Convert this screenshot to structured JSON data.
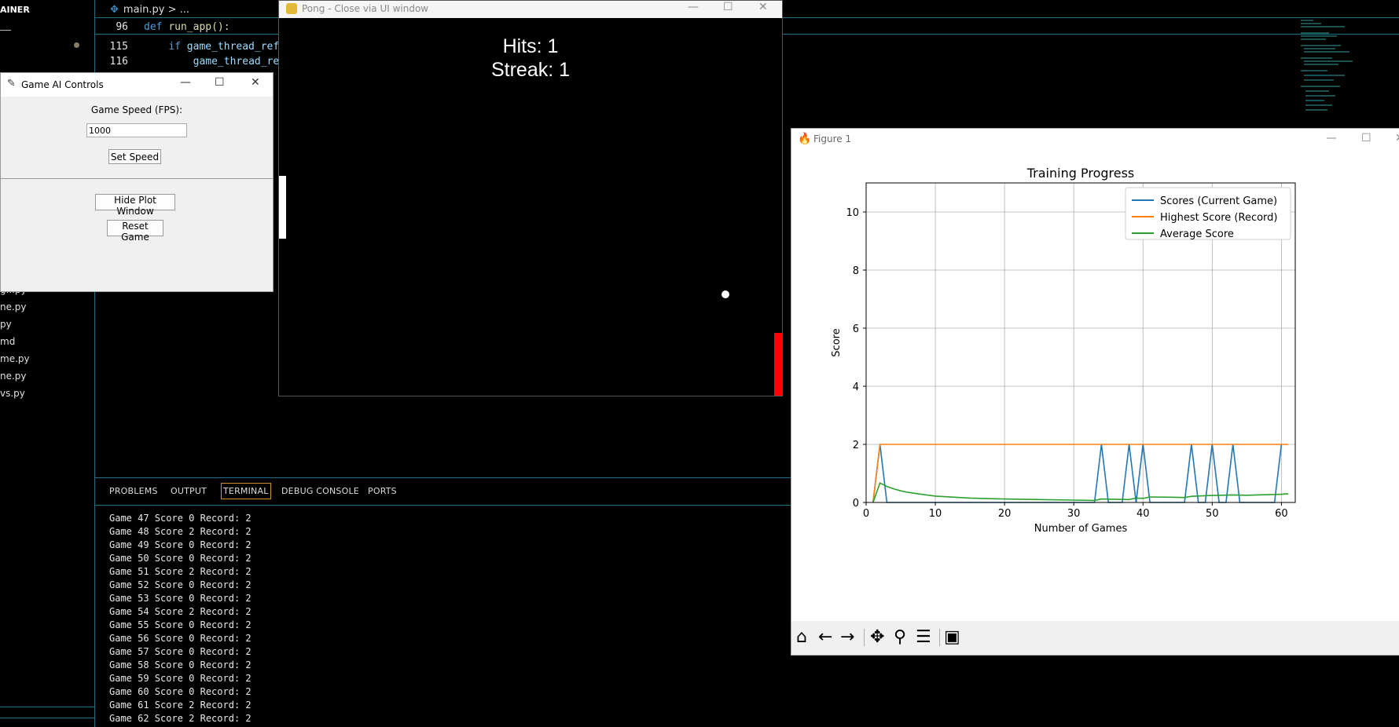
{
  "explorer": {
    "title": "AINER",
    "files": [
      "g...py",
      "ne.py",
      "py",
      "md",
      "me.py",
      "ne.py",
      "vs.py"
    ]
  },
  "editor": {
    "breadcrumb_file": "main.py",
    "breadcrumb_rest": "> ...",
    "lines": [
      {
        "num": "96",
        "kw": "def",
        "name": "run_app",
        "rest": "():"
      },
      {
        "num": "115",
        "indent": "    ",
        "kw": "if",
        "rest": " game_thread_ref"
      },
      {
        "num": "116",
        "indent": "        ",
        "kw": "",
        "rest": "game_thread_re"
      }
    ]
  },
  "panel": {
    "tabs": [
      "PROBLEMS",
      "OUTPUT",
      "TERMINAL",
      "DEBUG CONSOLE",
      "PORTS"
    ],
    "active_tab": "TERMINAL",
    "terminal_lines": [
      "Game 47 Score 0 Record: 2",
      "Game 48 Score 2 Record: 2",
      "Game 49 Score 0 Record: 2",
      "Game 50 Score 0 Record: 2",
      "Game 51 Score 2 Record: 2",
      "Game 52 Score 0 Record: 2",
      "Game 53 Score 0 Record: 2",
      "Game 54 Score 2 Record: 2",
      "Game 55 Score 0 Record: 2",
      "Game 56 Score 0 Record: 2",
      "Game 57 Score 0 Record: 2",
      "Game 58 Score 0 Record: 2",
      "Game 59 Score 0 Record: 2",
      "Game 60 Score 0 Record: 2",
      "Game 61 Score 2 Record: 2",
      "Game 62 Score 2 Record: 2"
    ]
  },
  "controls": {
    "title": "Game AI Controls",
    "speed_label": "Game Speed (FPS):",
    "speed_value": "1000",
    "set_speed": "Set Speed",
    "hide_plot": "Hide Plot Window",
    "reset": "Reset Game"
  },
  "pong": {
    "title": "Pong - Close via UI window",
    "hits": "Hits: 1",
    "streak": "Streak: 1"
  },
  "figure": {
    "title": "Figure 1",
    "tools": [
      "home-icon",
      "back-arrow-icon",
      "forward-arrow-icon",
      "pan-icon",
      "zoom-icon",
      "configure-icon",
      "save-icon"
    ]
  },
  "chart_data": {
    "type": "line",
    "title": "Training Progress",
    "xlabel": "Number of Games",
    "ylabel": "Score",
    "xlim": [
      0,
      62
    ],
    "ylim": [
      0,
      11
    ],
    "xticks": [
      0,
      10,
      20,
      30,
      40,
      50,
      60
    ],
    "yticks": [
      0,
      2,
      4,
      6,
      8,
      10
    ],
    "grid": true,
    "legend_position": "upper right",
    "series": [
      {
        "name": "Scores (Current Game)",
        "color": "#1f77b4",
        "x": [
          1,
          2,
          3,
          32,
          33,
          34,
          35,
          37,
          38,
          39,
          40,
          41,
          42,
          46,
          47,
          48,
          49,
          50,
          51,
          52,
          53,
          54,
          59,
          60
        ],
        "y": [
          0,
          2,
          0,
          0,
          0,
          2,
          0,
          0,
          2,
          0,
          2,
          0,
          0,
          0,
          2,
          0,
          0,
          2,
          0,
          0,
          2,
          0,
          0,
          2
        ]
      },
      {
        "name": "Highest Score (Record)",
        "color": "#ff7f0e",
        "x": [
          1,
          2,
          61
        ],
        "y": [
          0,
          2,
          2
        ]
      },
      {
        "name": "Average Score",
        "color": "#2ca02c",
        "x": [
          1,
          2,
          3,
          4,
          5,
          6,
          8,
          10,
          15,
          20,
          25,
          30,
          33,
          34,
          36,
          38,
          39,
          40,
          41,
          44,
          46,
          47,
          50,
          53,
          55,
          60,
          61
        ],
        "y": [
          0,
          0.67,
          0.55,
          0.47,
          0.4,
          0.35,
          0.28,
          0.22,
          0.15,
          0.12,
          0.1,
          0.08,
          0.07,
          0.12,
          0.11,
          0.1,
          0.15,
          0.14,
          0.19,
          0.18,
          0.17,
          0.21,
          0.24,
          0.26,
          0.25,
          0.28,
          0.3
        ]
      }
    ]
  }
}
